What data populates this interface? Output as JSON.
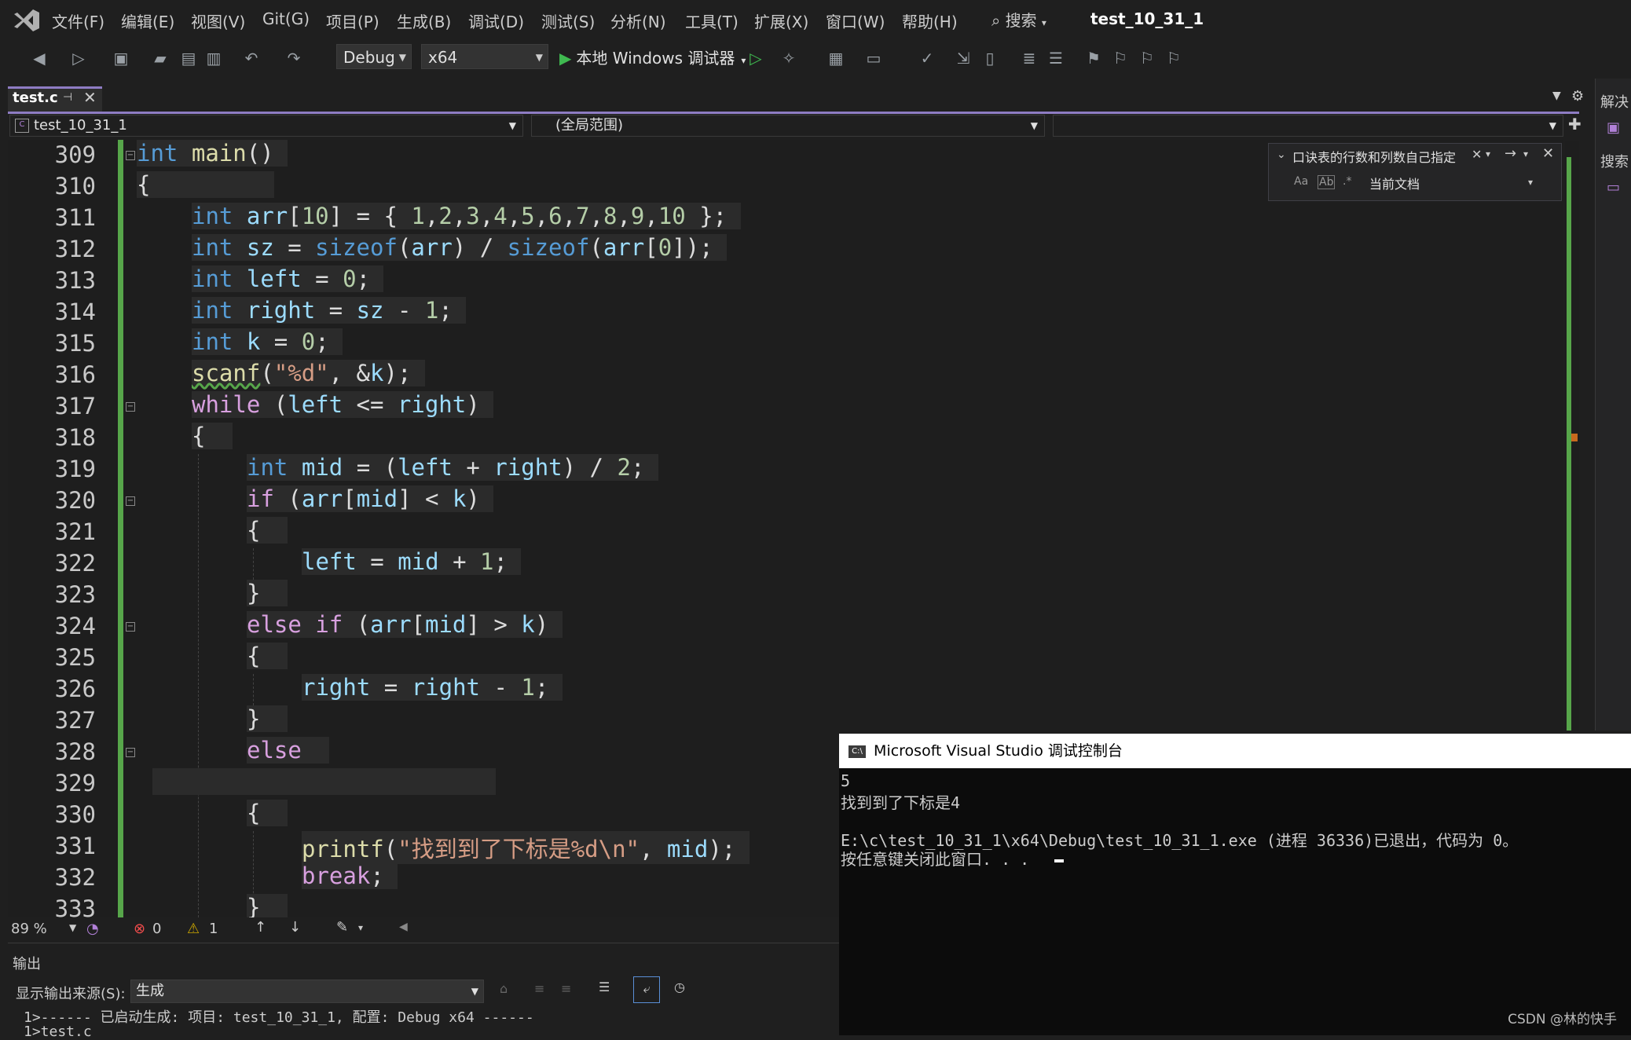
{
  "menu": {
    "items": [
      "文件(F)",
      "编辑(E)",
      "视图(V)",
      "Git(G)",
      "项目(P)",
      "生成(B)",
      "调试(D)",
      "测试(S)",
      "分析(N)",
      "工具(T)",
      "扩展(X)",
      "窗口(W)",
      "帮助(H)"
    ],
    "search_label": "搜索",
    "project_title": "test_10_31_1"
  },
  "toolbar": {
    "config": "Debug",
    "platform": "x64",
    "run_label": "本地 Windows 调试器"
  },
  "tab": {
    "label": "test.c"
  },
  "navbar": {
    "project": "test_10_31_1",
    "scope": "(全局范围)"
  },
  "find": {
    "query": "口诀表的行数和列数自己指定",
    "scope": "当前文档",
    "opt_case": "Aa",
    "opt_word": "Ab",
    "opt_regex": ".*"
  },
  "editor": {
    "line_numbers": [
      "309",
      "310",
      "311",
      "312",
      "313",
      "314",
      "315",
      "316",
      "317",
      "318",
      "319",
      "320",
      "321",
      "322",
      "323",
      "324",
      "325",
      "326",
      "327",
      "328",
      "329",
      "330",
      "331",
      "332",
      "333"
    ]
  },
  "status": {
    "zoom": "89 %",
    "errors": "0",
    "warnings": "1"
  },
  "output": {
    "title": "输出",
    "source_label": "显示输出来源(S):",
    "source_value": "生成",
    "line1": "1>------ 已启动生成: 项目: test_10_31_1, 配置: Debug x64 ------",
    "line2": "1>test.c"
  },
  "console": {
    "title": "Microsoft Visual Studio 调试控制台",
    "lines": [
      "5",
      "找到到了下标是4",
      "",
      "E:\\c\\test_10_31_1\\x64\\Debug\\test_10_31_1.exe (进程 36336)已退出，代码为 0。",
      "按任意键关闭此窗口. . ."
    ]
  },
  "right_panel": {
    "label1": "解决",
    "label2": "搜索"
  },
  "watermark": "CSDN @林的快手"
}
